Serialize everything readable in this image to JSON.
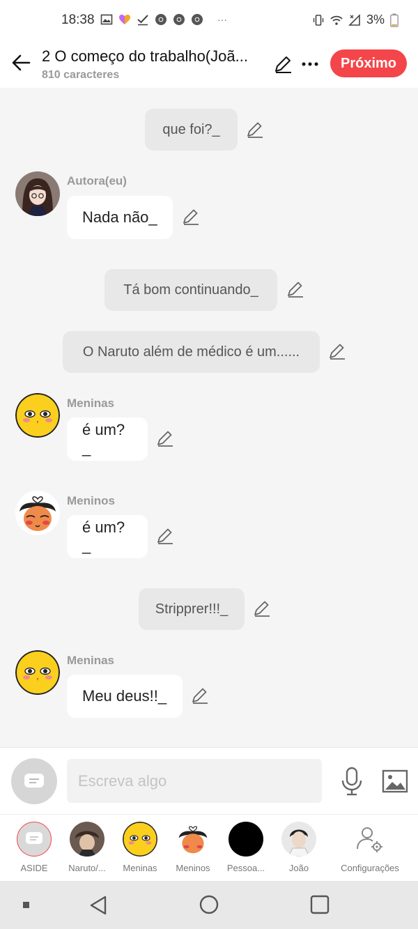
{
  "status": {
    "time": "18:38",
    "more": "···",
    "battery": "3%"
  },
  "header": {
    "title": "2 O começo do trabalho(Joã...",
    "subtitle": "810 caracteres",
    "next_label": "Próximo"
  },
  "messages": [
    {
      "type": "narration",
      "text": "que foi?_"
    },
    {
      "type": "character",
      "name": "Autora(eu)",
      "text": "Nada não_",
      "avatar": "girl-avatar"
    },
    {
      "type": "narration",
      "text": "Tá bom continuando_"
    },
    {
      "type": "narration",
      "text": "O Naruto além de médico é um......"
    },
    {
      "type": "character",
      "name": "Meninas",
      "text": "é um?_",
      "avatar": "yellow-face-avatar"
    },
    {
      "type": "character",
      "name": "Meninos",
      "text": "é um?_",
      "avatar": "blush-face-avatar"
    },
    {
      "type": "narration",
      "text": "Strip­prer!!!_"
    },
    {
      "type": "character",
      "name": "Meninas",
      "text": "Meu deus!!_",
      "avatar": "yellow-face-avatar"
    }
  ],
  "input": {
    "placeholder": "Escreva algo"
  },
  "characters": [
    {
      "label": "ASIDE",
      "icon": "aside-chat-icon"
    },
    {
      "label": "Naruto/...",
      "icon": "naruto-avatar"
    },
    {
      "label": "Meninas",
      "icon": "yellow-face-avatar"
    },
    {
      "label": "Meninos",
      "icon": "blush-face-avatar"
    },
    {
      "label": "Pessoa...",
      "icon": "black-avatar"
    },
    {
      "label": "João",
      "icon": "joao-avatar"
    },
    {
      "label": "Configurações",
      "icon": "settings-user-icon"
    }
  ],
  "colors": {
    "accent": "#f4454a",
    "background": "#f5f5f5",
    "narration_bubble": "#e8e8e8",
    "character_bubble": "#ffffff"
  }
}
